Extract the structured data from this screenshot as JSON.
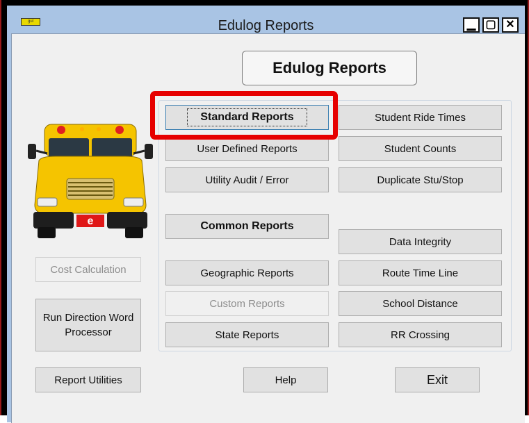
{
  "window": {
    "title": "Edulog Reports",
    "icon_text": "gul",
    "minimize": "▁",
    "maximize": "▢",
    "close": "✕"
  },
  "heading": "Edulog Reports",
  "bus_logo_letter": "e",
  "left_buttons": {
    "cost_calculation": "Cost Calculation",
    "run_direction_line1": "Run Direction Word",
    "run_direction_line2": "Processor",
    "report_utilities": "Report Utilities"
  },
  "report_buttons": {
    "standard_reports": "Standard Reports",
    "user_defined_reports": "User Defined Reports",
    "utility_audit_error": "Utility Audit / Error",
    "common_reports": "Common Reports",
    "geographic_reports": "Geographic Reports",
    "custom_reports": "Custom Reports",
    "state_reports": "State Reports",
    "student_ride_times": "Student Ride Times",
    "student_counts": "Student Counts",
    "duplicate_stu_stop": "Duplicate Stu/Stop",
    "data_integrity": "Data Integrity",
    "route_time_line": "Route Time Line",
    "school_distance": "School Distance",
    "rr_crossing": "RR Crossing"
  },
  "bottom_buttons": {
    "help": "Help",
    "exit": "Exit"
  },
  "colors": {
    "title_bar": "#a9c4e4",
    "highlight": "#e60000",
    "bus_yellow": "#f5c400"
  }
}
